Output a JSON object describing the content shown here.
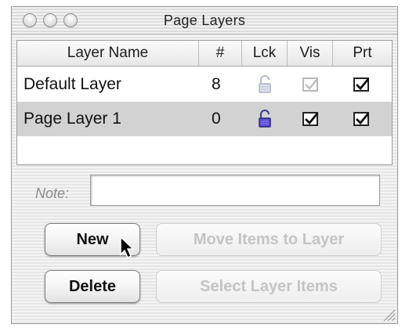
{
  "window": {
    "title": "Page Layers"
  },
  "table": {
    "columns": [
      "Layer Name",
      "#",
      "Lck",
      "Vis",
      "Prt"
    ],
    "rows": [
      {
        "name": "Default Layer",
        "count": "8",
        "locked": false,
        "visible": true,
        "printable": true,
        "visible_enabled": false,
        "selected": false
      },
      {
        "name": "Page Layer 1",
        "count": "0",
        "locked": true,
        "visible": true,
        "printable": true,
        "visible_enabled": true,
        "selected": true
      }
    ]
  },
  "note": {
    "label": "Note:",
    "value": ""
  },
  "buttons": {
    "new": "New",
    "delete": "Delete",
    "move_items": "Move Items to Layer",
    "select_items": "Select Layer Items"
  },
  "icons": {
    "window_controls": [
      "close-icon",
      "minimize-icon",
      "zoom-icon"
    ],
    "lock": "lock-icon",
    "cursor": "arrow-cursor-icon",
    "resize": "resize-grip-icon"
  },
  "colors": {
    "selected_row": "#d2d2d2",
    "lock_active": "#4a3fc4",
    "lock_inactive": "#aeb4c6"
  }
}
